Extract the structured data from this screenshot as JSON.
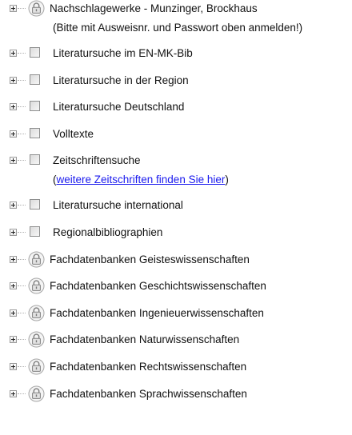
{
  "tree": {
    "items": [
      {
        "label": "Nachschlagewerke - Munzinger, Brockhaus",
        "note": "(Bitte mit Ausweisnr. und Passwort oben anmelden!)",
        "icon": "lock-icon"
      },
      {
        "label": "Literatursuche im EN-MK-Bib",
        "icon": "checkbox"
      },
      {
        "label": "Literatursuche in der Region",
        "icon": "checkbox"
      },
      {
        "label": "Literatursuche Deutschland",
        "icon": "checkbox"
      },
      {
        "label": "Volltexte",
        "icon": "checkbox"
      },
      {
        "label": "Zeitschriftensuche",
        "note_open": "(",
        "link_text": "weitere Zeitschriften finden Sie hier",
        "note_close": ")",
        "icon": "checkbox"
      },
      {
        "label": "Literatursuche international",
        "icon": "checkbox"
      },
      {
        "label": "Regionalbibliographien",
        "icon": "checkbox"
      },
      {
        "label": "Fachdatenbanken Geisteswissenschaften",
        "icon": "lock-icon"
      },
      {
        "label": "Fachdatenbanken Geschichtswissenschaften",
        "icon": "lock-icon"
      },
      {
        "label": "Fachdatenbanken Ingenieuerwissenschaften",
        "icon": "lock-icon"
      },
      {
        "label": "Fachdatenbanken Naturwissenschaften",
        "icon": "lock-icon"
      },
      {
        "label": "Fachdatenbanken Rechtswissenschaften",
        "icon": "lock-icon"
      },
      {
        "label": "Fachdatenbanken Sprachwissenschaften",
        "icon": "lock-icon"
      }
    ]
  },
  "colors": {
    "text": "#111111",
    "link": "#1a1aee",
    "lock_outline": "#8a8a8a",
    "lock_fill": "#e2e2e2"
  }
}
